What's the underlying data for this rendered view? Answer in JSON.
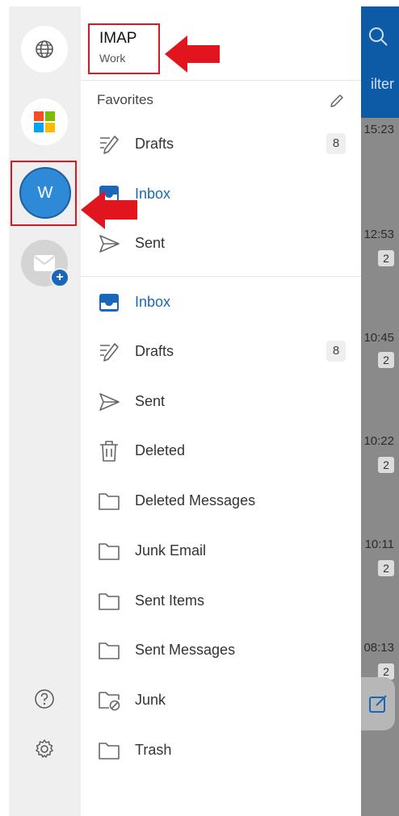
{
  "account": {
    "name": "IMAP",
    "type": "Work",
    "avatar_letter": "W"
  },
  "favorites": {
    "label": "Favorites",
    "items": [
      {
        "label": "Drafts",
        "icon": "drafts-icon",
        "count": "8",
        "active": false
      },
      {
        "label": "Inbox",
        "icon": "inbox-icon",
        "count": "",
        "active": true
      },
      {
        "label": "Sent",
        "icon": "sent-icon",
        "count": "",
        "active": false
      }
    ]
  },
  "folders": [
    {
      "label": "Inbox",
      "icon": "inbox-icon",
      "count": "",
      "active": true
    },
    {
      "label": "Drafts",
      "icon": "drafts-icon",
      "count": "8",
      "active": false
    },
    {
      "label": "Sent",
      "icon": "sent-icon",
      "count": "",
      "active": false
    },
    {
      "label": "Deleted",
      "icon": "trash-icon",
      "count": "",
      "active": false
    },
    {
      "label": "Deleted Messages",
      "icon": "folder-icon",
      "count": "",
      "active": false
    },
    {
      "label": "Junk Email",
      "icon": "folder-icon",
      "count": "",
      "active": false
    },
    {
      "label": "Sent Items",
      "icon": "folder-icon",
      "count": "",
      "active": false
    },
    {
      "label": "Sent Messages",
      "icon": "folder-icon",
      "count": "",
      "active": false
    },
    {
      "label": "Junk",
      "icon": "junk-folder-icon",
      "count": "",
      "active": false
    },
    {
      "label": "Trash",
      "icon": "folder-icon",
      "count": "",
      "active": false
    }
  ],
  "background_list": {
    "header_text": "ilter",
    "times": [
      "15:23",
      "12:53",
      "10:45",
      "10:22",
      "10:11",
      "08:13"
    ],
    "badges": [
      "2",
      "2",
      "2",
      "2",
      "2"
    ]
  },
  "colors": {
    "accent": "#1a66b8",
    "avatar": "#2e8ad6",
    "annotation": "#e0151d"
  }
}
